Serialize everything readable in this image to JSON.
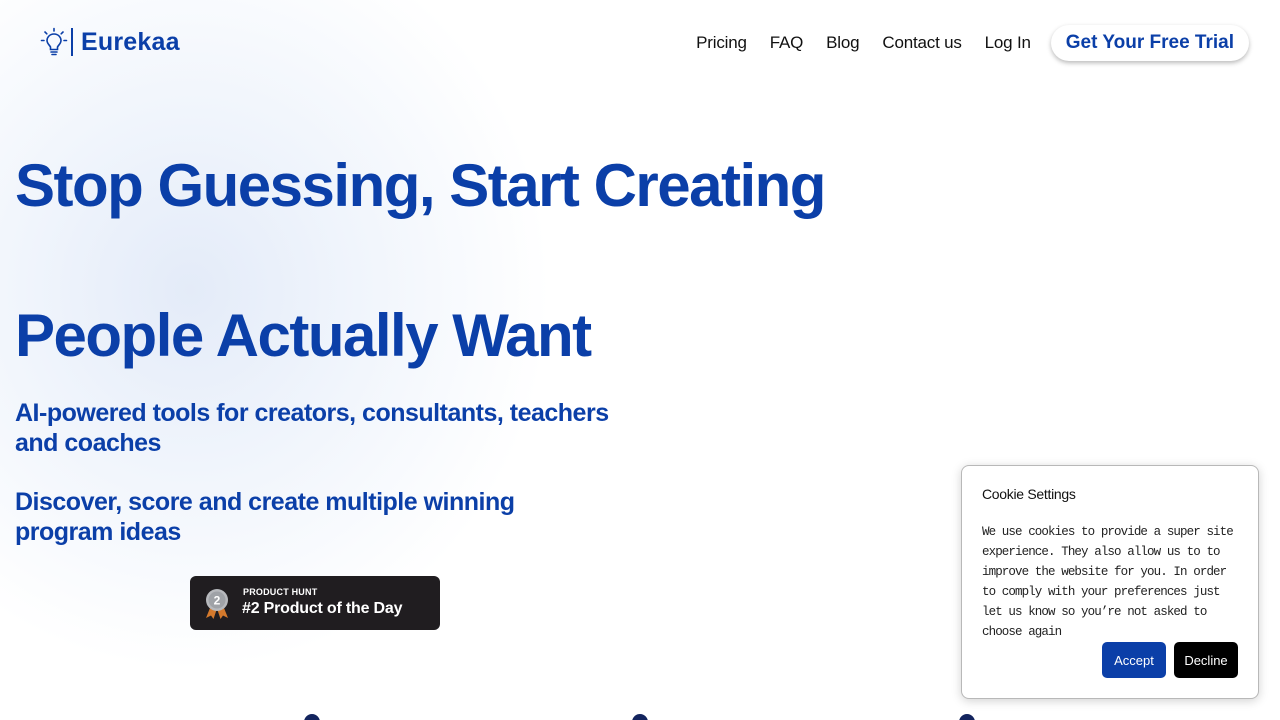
{
  "brand": {
    "name": "Eurekaa",
    "icon": "lightbulb-icon",
    "color": "#0b3fa8"
  },
  "nav": {
    "links": [
      "Pricing",
      "FAQ",
      "Blog",
      "Contact us",
      "Log In"
    ],
    "cta_label": "Get Your Free Trial"
  },
  "hero": {
    "title_line1": "Stop Guessing, Start Creating",
    "title_line2": "People Actually Want",
    "subtitle1": "AI-powered tools for creators, consultants, teachers and coaches",
    "subtitle2": "Discover, score and create multiple winning program ideas"
  },
  "product_hunt": {
    "kicker": "PRODUCT HUNT",
    "title": "#2 Product of the Day",
    "medal_rank": "2",
    "medal_icon": "silver-medal-icon"
  },
  "cookie": {
    "title": "Cookie Settings",
    "text": "We use cookies to provide a super site experience. They also allow us to to improve the website for you. In order to comply with your preferences just let us know so you’re not asked to choose again",
    "accept_label": "Accept",
    "decline_label": "Decline"
  },
  "colors": {
    "accent": "#0b3fa8",
    "badge_bg": "#201d20",
    "dot": "#13245e"
  }
}
